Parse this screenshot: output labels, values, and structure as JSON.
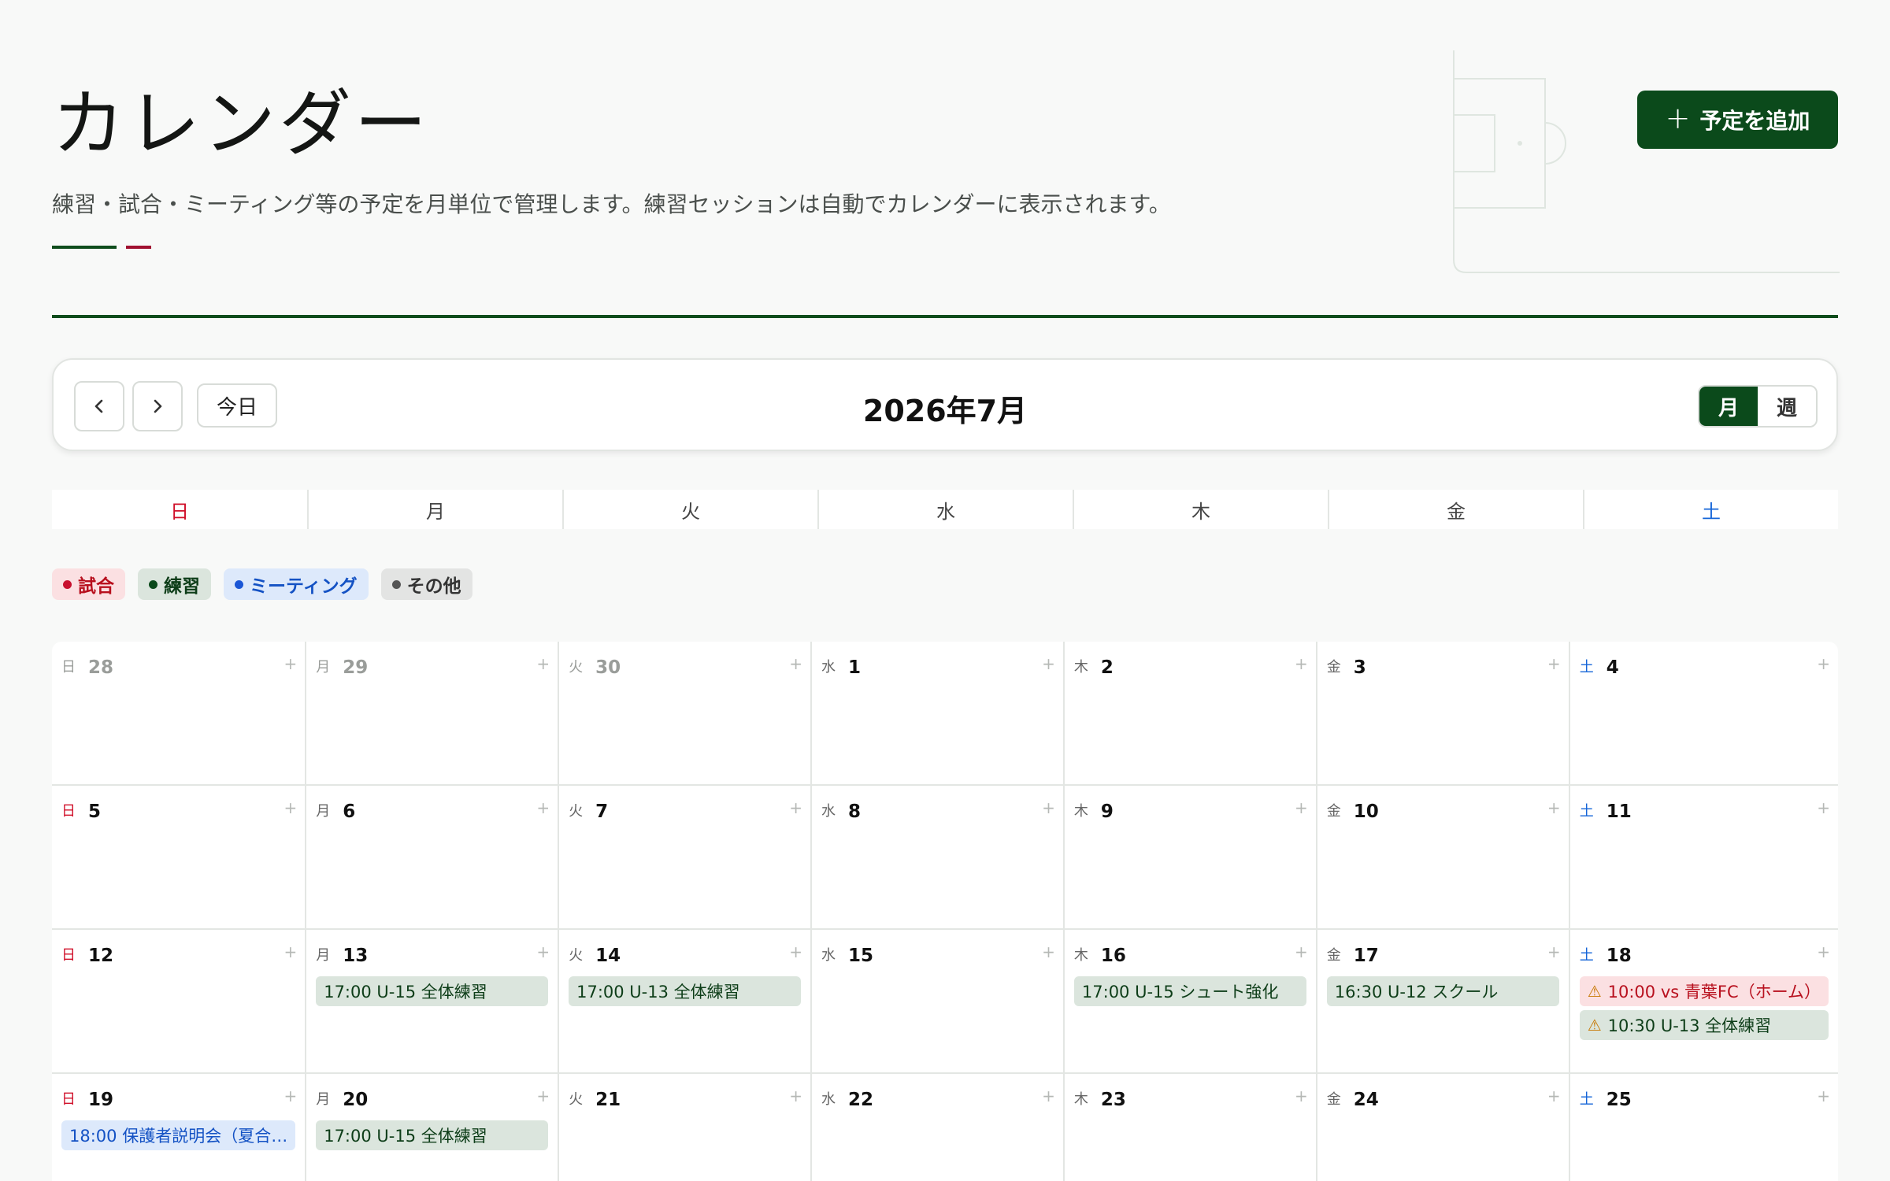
{
  "header": {
    "title": "カレンダー",
    "description": "練習・試合・ミーティング等の予定を月単位で管理します。練習セッションは自動でカレンダーに表示されます。",
    "add_button_label": "予定を追加"
  },
  "toolbar": {
    "today_label": "今日",
    "month_title": "2026年7月",
    "view_month_label": "月",
    "view_week_label": "週"
  },
  "weekdays": [
    "日",
    "月",
    "火",
    "水",
    "木",
    "金",
    "土"
  ],
  "legend": [
    {
      "label": "試合",
      "color": "#c8102e",
      "bg": "#fbe0e2",
      "text_color": "#b8101e"
    },
    {
      "label": "練習",
      "color": "#0b4a1b",
      "bg": "#dbe5dd",
      "text_color": "#0d3d18"
    },
    {
      "label": "ミーティング",
      "color": "#1a56d6",
      "bg": "#dde9fb",
      "text_color": "#1452c4"
    },
    {
      "label": "その他",
      "color": "#555555",
      "bg": "#e3e4e3",
      "text_color": "#333333"
    }
  ],
  "days": [
    {
      "dow": "日",
      "num": "28",
      "outside": true,
      "events": []
    },
    {
      "dow": "月",
      "num": "29",
      "outside": true,
      "events": []
    },
    {
      "dow": "火",
      "num": "30",
      "outside": true,
      "events": []
    },
    {
      "dow": "水",
      "num": "1",
      "events": []
    },
    {
      "dow": "木",
      "num": "2",
      "events": []
    },
    {
      "dow": "金",
      "num": "3",
      "events": []
    },
    {
      "dow": "土",
      "num": "4",
      "events": []
    },
    {
      "dow": "日",
      "num": "5",
      "events": []
    },
    {
      "dow": "月",
      "num": "6",
      "events": []
    },
    {
      "dow": "火",
      "num": "7",
      "events": []
    },
    {
      "dow": "水",
      "num": "8",
      "events": []
    },
    {
      "dow": "木",
      "num": "9",
      "events": []
    },
    {
      "dow": "金",
      "num": "10",
      "events": []
    },
    {
      "dow": "土",
      "num": "11",
      "events": []
    },
    {
      "dow": "日",
      "num": "12",
      "events": []
    },
    {
      "dow": "月",
      "num": "13",
      "events": [
        {
          "type": "practice",
          "text": "17:00 U-15 全体練習"
        }
      ]
    },
    {
      "dow": "火",
      "num": "14",
      "events": [
        {
          "type": "practice",
          "text": "17:00 U-13 全体練習"
        }
      ]
    },
    {
      "dow": "水",
      "num": "15",
      "events": []
    },
    {
      "dow": "木",
      "num": "16",
      "events": [
        {
          "type": "practice",
          "text": "17:00 U-15 シュート強化"
        }
      ]
    },
    {
      "dow": "金",
      "num": "17",
      "events": [
        {
          "type": "practice",
          "text": "16:30 U-12 スクール"
        }
      ]
    },
    {
      "dow": "土",
      "num": "18",
      "events": [
        {
          "type": "match",
          "text": "10:00 vs 青葉FC（ホーム）",
          "warning": true
        },
        {
          "type": "practice",
          "text": "10:30 U-13 全体練習",
          "warning": true
        }
      ]
    },
    {
      "dow": "日",
      "num": "19",
      "events": [
        {
          "type": "meeting",
          "text": "18:00 保護者説明会（夏合…"
        }
      ]
    },
    {
      "dow": "月",
      "num": "20",
      "events": [
        {
          "type": "practice",
          "text": "17:00 U-15 全体練習"
        }
      ]
    },
    {
      "dow": "火",
      "num": "21",
      "events": []
    },
    {
      "dow": "水",
      "num": "22",
      "events": []
    },
    {
      "dow": "木",
      "num": "23",
      "events": []
    },
    {
      "dow": "金",
      "num": "24",
      "events": []
    },
    {
      "dow": "土",
      "num": "25",
      "events": []
    }
  ],
  "icons": {
    "prev": "chevron-left-icon",
    "next": "chevron-right-icon",
    "add": "plus-icon",
    "warning": "warning-icon",
    "cell_add": "plus-icon"
  }
}
